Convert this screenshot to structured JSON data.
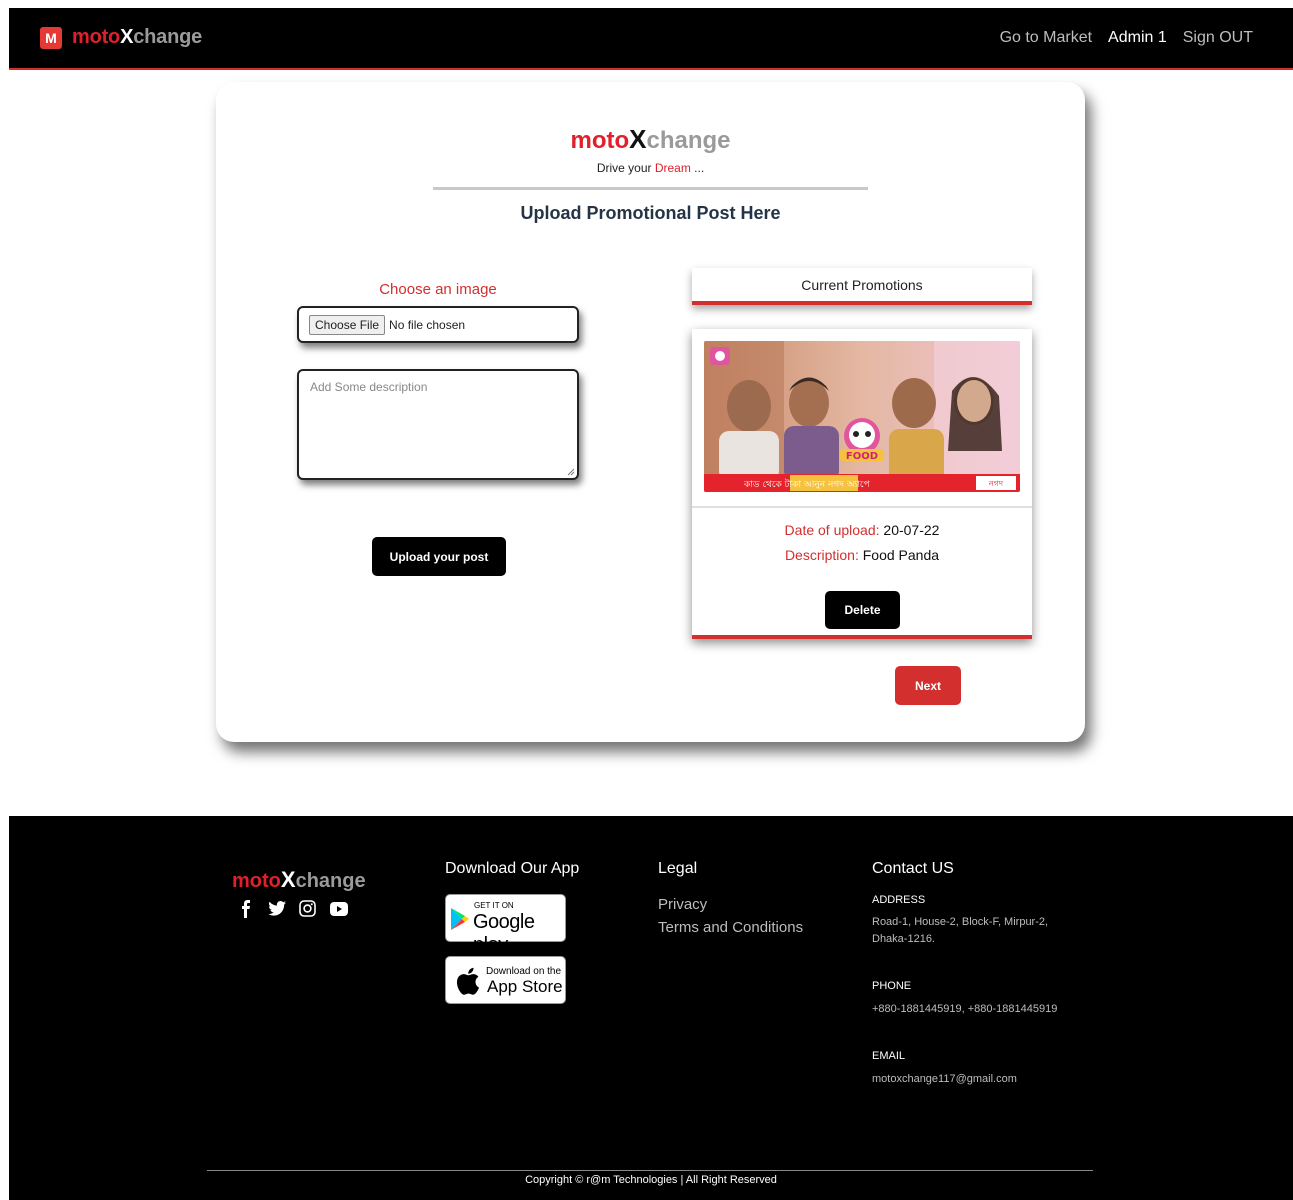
{
  "navbar": {
    "logo_letter": "M",
    "brand_moto": "moto",
    "brand_x": "X",
    "brand_change": "change",
    "links": [
      {
        "label": "Go to Market"
      },
      {
        "label": "Admin 1"
      },
      {
        "label": "Sign OUT"
      }
    ]
  },
  "card": {
    "brand_moto": "moto",
    "brand_x": "X",
    "brand_change": "change",
    "tagline_prefix": "Drive your ",
    "tagline_highlight": "Dream",
    "tagline_suffix": " ...",
    "heading": "Upload Promotional Post Here",
    "choose_label": "Choose an image",
    "file_button": "Choose File",
    "file_status": "No file chosen",
    "description_placeholder": "Add Some description",
    "upload_button": "Upload your post"
  },
  "promotions": {
    "header": "Current Promotions",
    "items": [
      {
        "date_label": "Date of upload:",
        "date_value": "20-07-22",
        "description_label": "Description:",
        "description_value": "Food Panda",
        "delete_label": "Delete",
        "banner_text": "কাড থেকে টাকা আনুন নগদ অ্যাপে",
        "banner_logo": "নগদ",
        "food_text": "FOOD"
      }
    ],
    "next_button": "Next"
  },
  "footer": {
    "brand_moto": "moto",
    "brand_x": "X",
    "brand_change": "change",
    "socials": [
      "facebook-icon",
      "twitter-icon",
      "instagram-icon",
      "youtube-icon"
    ],
    "download_title": "Download Our App",
    "google_play_small": "GET IT ON",
    "google_play_big": "Google play",
    "app_store_small": "Download on the",
    "app_store_big": "App Store",
    "legal_title": "Legal",
    "legal_links": [
      "Privacy",
      "Terms and Conditions"
    ],
    "contact_title": "Contact US",
    "address_label": "ADDRESS",
    "address_line1": "Road-1, House-2, Block-F, Mirpur-2,",
    "address_line2": "Dhaka-1216.",
    "phone_label": "PHONE",
    "phone_value": "+880-1881445919, +880-1881445919",
    "email_label": "EMAIL",
    "email_value": "motoxchange117@gmail.com",
    "copyright": "Copyright © r@m Technologies | All Right Reserved"
  },
  "colors": {
    "accent": "#d32f2f",
    "dark": "#000000"
  }
}
